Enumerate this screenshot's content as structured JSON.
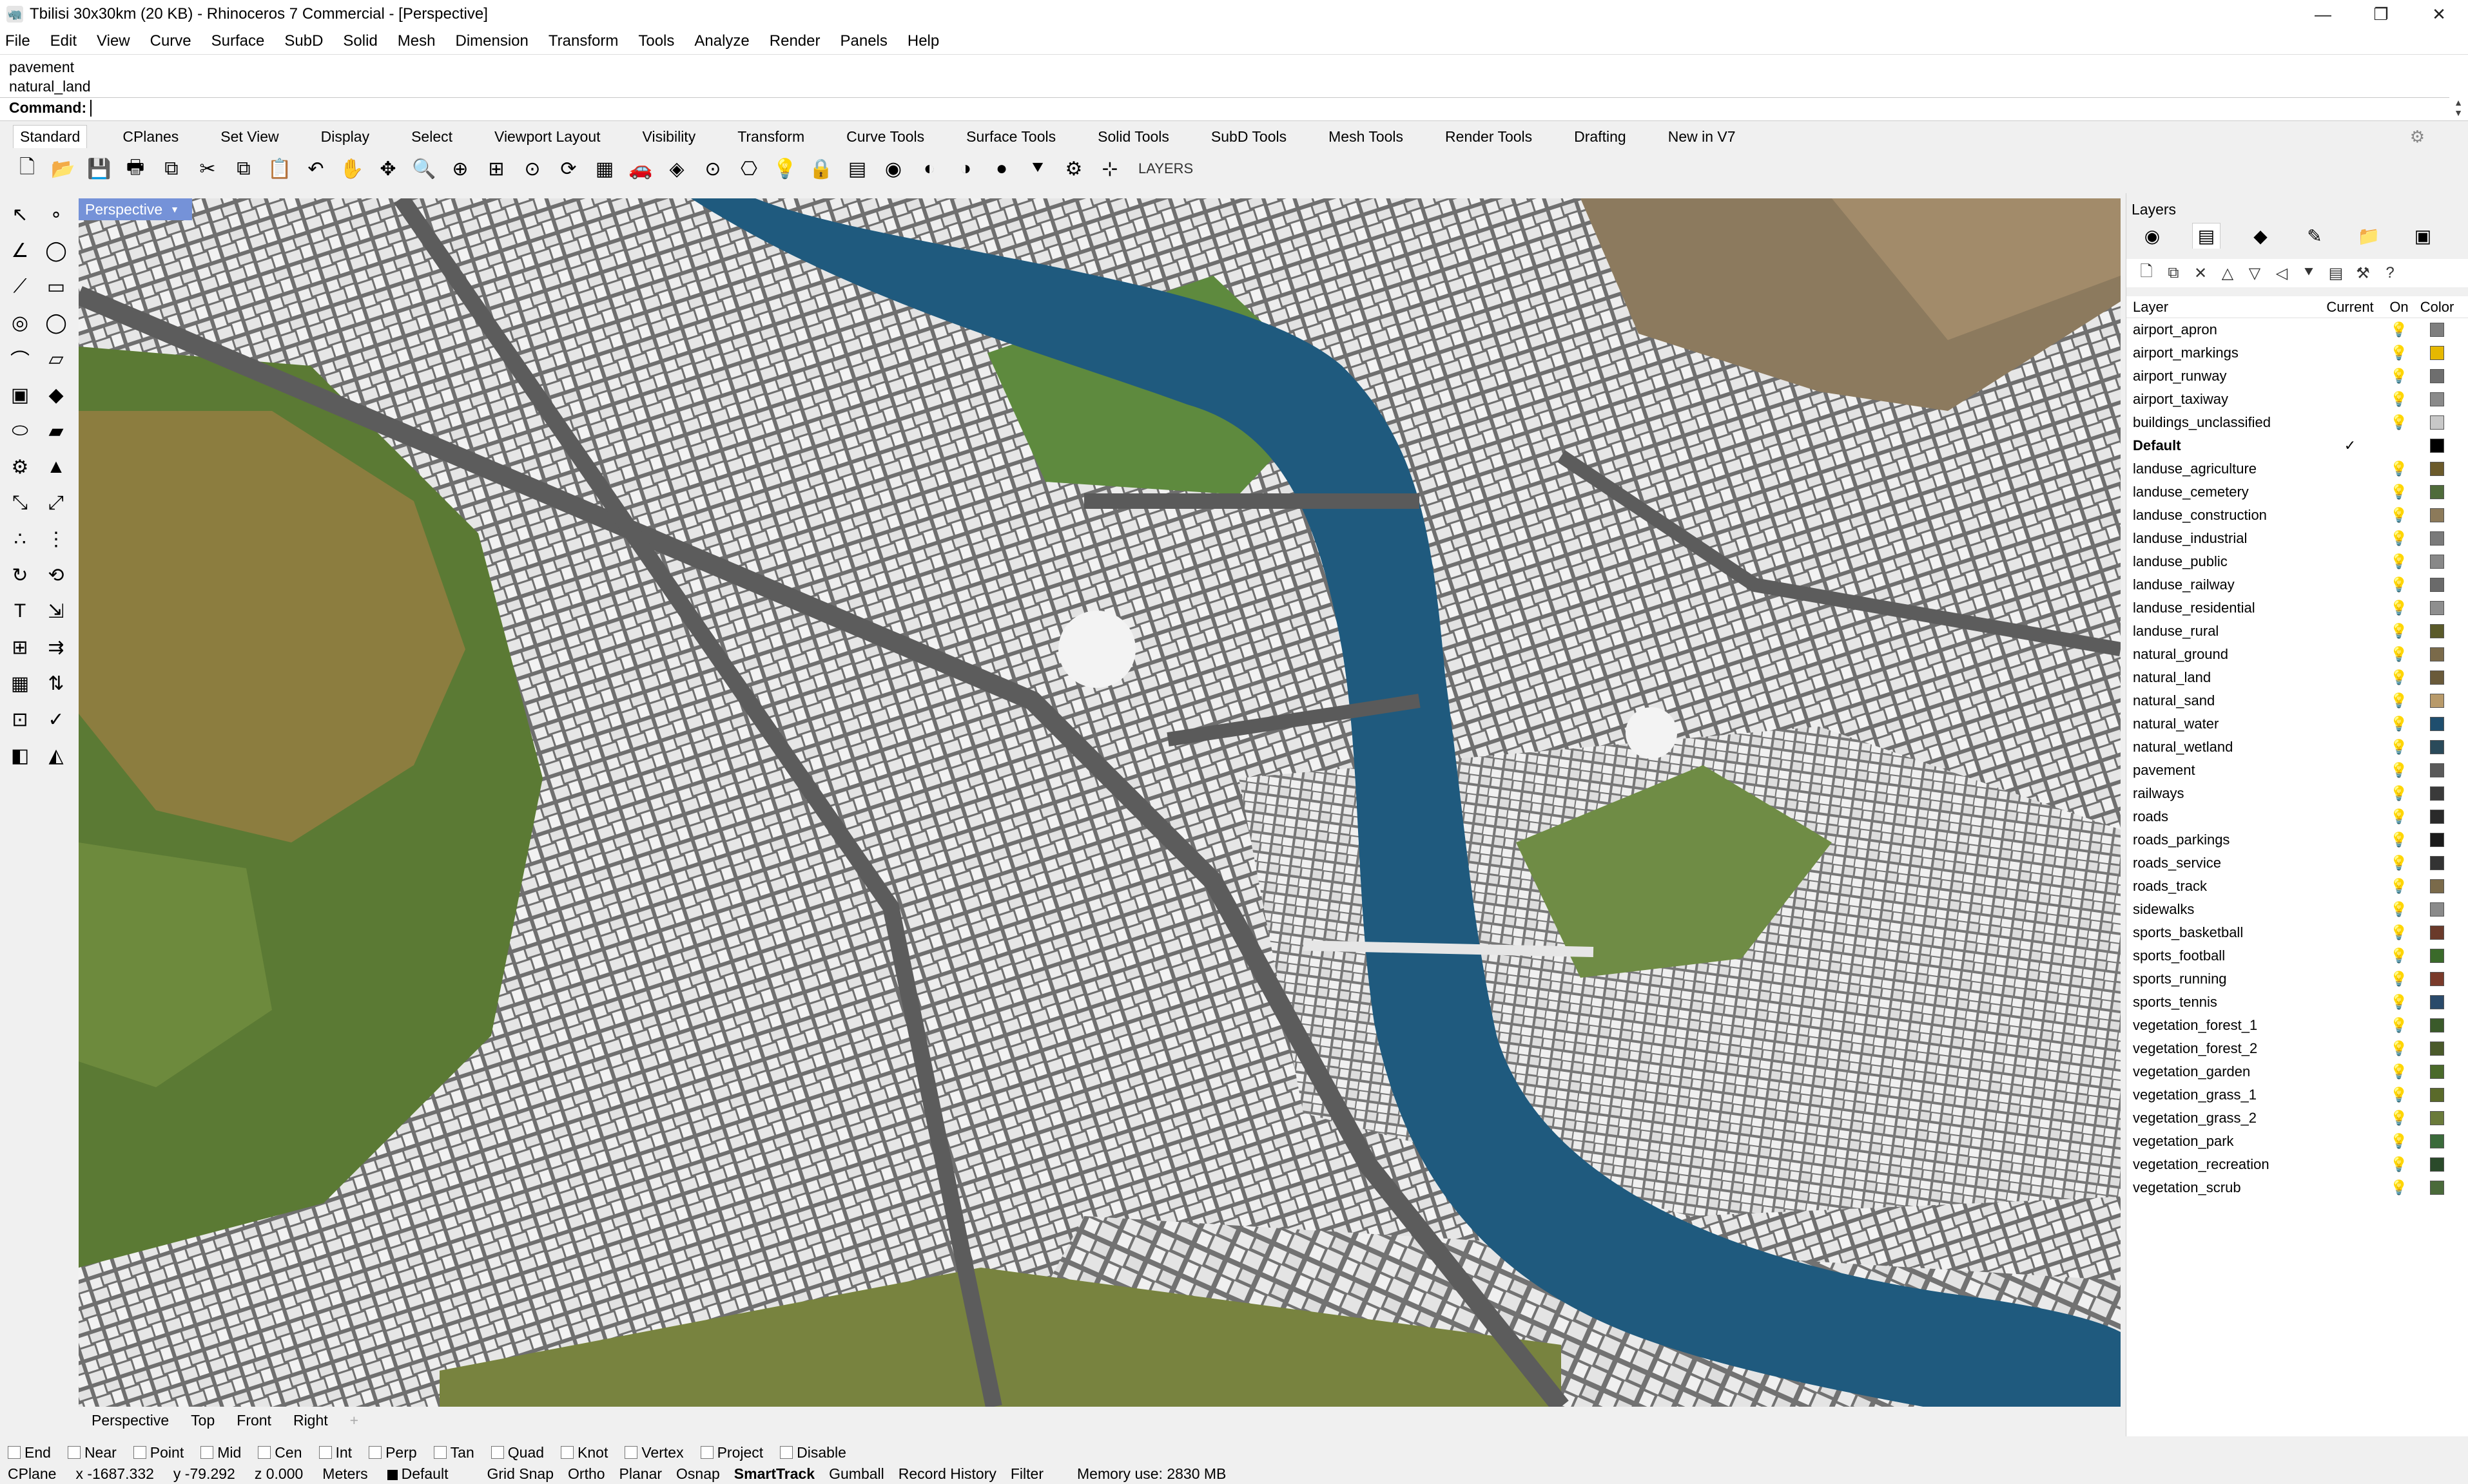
{
  "window": {
    "title": "Tbilisi 30x30km (20 KB) - Rhinoceros 7 Commercial - [Perspective]",
    "controls": {
      "minimize": "—",
      "maximize": "❐",
      "close": "✕"
    }
  },
  "menu": [
    "File",
    "Edit",
    "View",
    "Curve",
    "Surface",
    "SubD",
    "Solid",
    "Mesh",
    "Dimension",
    "Transform",
    "Tools",
    "Analyze",
    "Render",
    "Panels",
    "Help"
  ],
  "command": {
    "history": [
      "pavement",
      "natural_land"
    ],
    "prompt": "Command:",
    "value": ""
  },
  "toolbar_tabs": {
    "items": [
      "Standard",
      "CPlanes",
      "Set View",
      "Display",
      "Select",
      "Viewport Layout",
      "Visibility",
      "Transform",
      "Curve Tools",
      "Surface Tools",
      "Solid Tools",
      "SubD Tools",
      "Mesh Tools",
      "Render Tools",
      "Drafting",
      "New in V7"
    ],
    "active": "Standard"
  },
  "toolbar": {
    "icons": [
      "new-file-icon",
      "open-file-icon",
      "save-icon",
      "print-icon",
      "import-icon",
      "cut-icon",
      "copy-icon",
      "paste-icon",
      "undo-icon",
      "pan-icon",
      "move-view-icon",
      "zoom-icon",
      "zoom-window-icon",
      "zoom-extents-icon",
      "zoom-selected-icon",
      "rotate-view-icon",
      "grid-icon",
      "car-icon",
      "properties-icon",
      "point-icon",
      "named-views-icon",
      "lightbulb-icon",
      "lock-icon",
      "layer-icon",
      "color-wheel-icon",
      "shade-icon",
      "render-preview-icon",
      "sphere-icon",
      "filter-icon",
      "gear-icon",
      "snap-icon"
    ],
    "glyphs": [
      "🗋",
      "📂",
      "💾",
      "🖶",
      "⧉",
      "✂",
      "⧉",
      "📋",
      "↶",
      "✋",
      "✥",
      "🔍",
      "⊕",
      "⊞",
      "⊙",
      "⟳",
      "▦",
      "🚗",
      "◈",
      "⊙",
      "⎔",
      "💡",
      "🔒",
      "▤",
      "◉",
      "◐",
      "◑",
      "●",
      "⯆",
      "⚙",
      "⊹"
    ],
    "layers_label": "LAYERS"
  },
  "left_toolbar": {
    "glyphs": [
      "↖",
      "∘",
      "∠",
      "◯",
      "⟋",
      "▭",
      "◎",
      "◯",
      "⌒",
      "▱",
      "▣",
      "◆",
      "⬭",
      "▰",
      "⚙",
      "▲",
      "⤡",
      "⤢",
      "∴",
      "⋮",
      "↻",
      "⟲",
      "T",
      "⇲",
      "⊞",
      "⇉",
      "▦",
      "⇅",
      "⊡",
      "✓",
      "◧",
      "◭"
    ]
  },
  "viewport": {
    "label": "Perspective",
    "tabs": [
      "Perspective",
      "Top",
      "Front",
      "Right"
    ],
    "add_tab": "+"
  },
  "osnaps": [
    "End",
    "Near",
    "Point",
    "Mid",
    "Cen",
    "Int",
    "Perp",
    "Tan",
    "Quad",
    "Knot",
    "Vertex",
    "Project",
    "Disable"
  ],
  "status": {
    "cplane": "CPlane",
    "x": "x -1687.332",
    "y": "y -79.292",
    "z": "z 0.000",
    "units": "Meters",
    "layer": "Default",
    "toggles": [
      "Grid Snap",
      "Ortho",
      "Planar",
      "Osnap",
      "SmartTrack",
      "Gumball",
      "Record History",
      "Filter"
    ],
    "active_toggle": "SmartTrack",
    "memory": "Memory use: 2830 MB"
  },
  "layers_panel": {
    "title": "Layers",
    "tab_icons": [
      "◉",
      "▤",
      "◆",
      "✎",
      "📁",
      "▣"
    ],
    "tool_icons": [
      "🗋",
      "⧉",
      "✕",
      "△",
      "▽",
      "◁",
      "⯆",
      "▤",
      "⚒",
      "?"
    ],
    "headers": {
      "name": "Layer",
      "current": "Current",
      "on": "On",
      "color": "Color"
    },
    "current_mark": "✓",
    "on_mark": "💡",
    "layers": [
      {
        "name": "airport_apron",
        "color": "#7f7f7f"
      },
      {
        "name": "airport_markings",
        "color": "#e6b800"
      },
      {
        "name": "airport_runway",
        "color": "#6e6e6e"
      },
      {
        "name": "airport_taxiway",
        "color": "#8a8a8a"
      },
      {
        "name": "buildings_unclassified",
        "color": "#c8c8c8"
      },
      {
        "name": "Default",
        "color": "#000000",
        "current": true
      },
      {
        "name": "landuse_agriculture",
        "color": "#6b5a2a"
      },
      {
        "name": "landuse_cemetery",
        "color": "#4f6b3a"
      },
      {
        "name": "landuse_construction",
        "color": "#8c7a5a"
      },
      {
        "name": "landuse_industrial",
        "color": "#7a7a7a"
      },
      {
        "name": "landuse_public",
        "color": "#888888"
      },
      {
        "name": "landuse_railway",
        "color": "#6a6a6a"
      },
      {
        "name": "landuse_residential",
        "color": "#8e8e8e"
      },
      {
        "name": "landuse_rural",
        "color": "#5a5a2a"
      },
      {
        "name": "natural_ground",
        "color": "#7a6a4a"
      },
      {
        "name": "natural_land",
        "color": "#6a5a3a"
      },
      {
        "name": "natural_sand",
        "color": "#b89a6a"
      },
      {
        "name": "natural_water",
        "color": "#1f4e6e"
      },
      {
        "name": "natural_wetland",
        "color": "#2a4a5a"
      },
      {
        "name": "pavement",
        "color": "#5a5a5a"
      },
      {
        "name": "railways",
        "color": "#3a3a3a"
      },
      {
        "name": "roads",
        "color": "#2a2a2a"
      },
      {
        "name": "roads_parkings",
        "color": "#1a1a1a"
      },
      {
        "name": "roads_service",
        "color": "#333333"
      },
      {
        "name": "roads_track",
        "color": "#7a6a4a"
      },
      {
        "name": "sidewalks",
        "color": "#8a8a8a"
      },
      {
        "name": "sports_basketball",
        "color": "#6a3a2a"
      },
      {
        "name": "sports_football",
        "color": "#3a6a2a"
      },
      {
        "name": "sports_running",
        "color": "#7a3a2a"
      },
      {
        "name": "sports_tennis",
        "color": "#2a4a6a"
      },
      {
        "name": "vegetation_forest_1",
        "color": "#3a5a2a"
      },
      {
        "name": "vegetation_forest_2",
        "color": "#4a5a2a"
      },
      {
        "name": "vegetation_garden",
        "color": "#4a6a2a"
      },
      {
        "name": "vegetation_grass_1",
        "color": "#5a6a2a"
      },
      {
        "name": "vegetation_grass_2",
        "color": "#6a7a3a"
      },
      {
        "name": "vegetation_park",
        "color": "#3a6a3a"
      },
      {
        "name": "vegetation_recreation",
        "color": "#2a4a2a"
      },
      {
        "name": "vegetation_scrub",
        "color": "#4a6a3a"
      }
    ]
  },
  "colors": {
    "accent": "#7592d8",
    "water": "#1f5a7e",
    "forest": "#5b7a34",
    "dry_grass": "#8c7d3f",
    "building": "#ececec",
    "street": "#6f6f6f"
  }
}
